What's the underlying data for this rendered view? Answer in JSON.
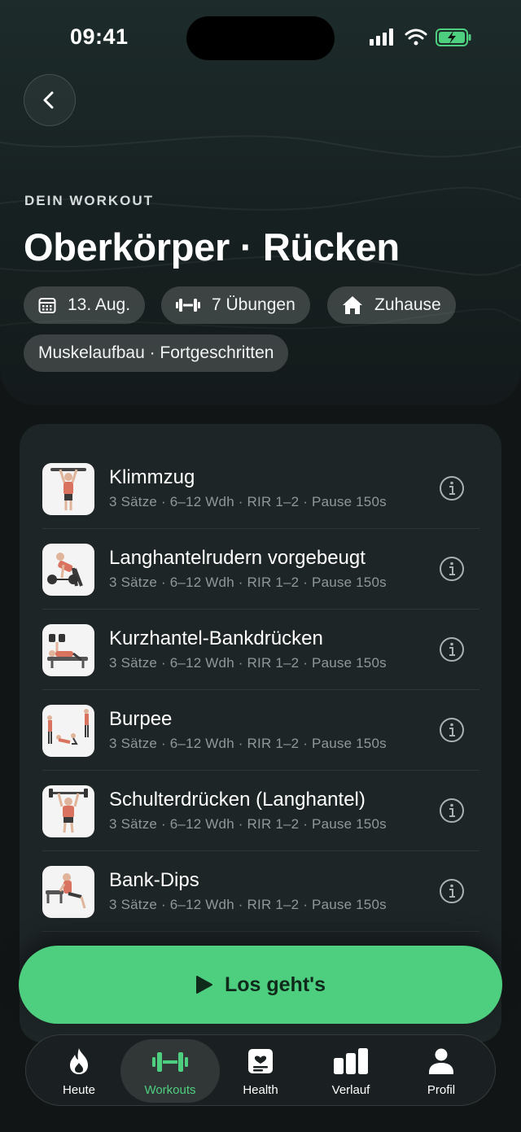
{
  "status": {
    "time": "09:41"
  },
  "header": {
    "eyebrow": "DEIN WORKOUT",
    "title": "Oberkörper · Rücken",
    "chips": [
      {
        "icon": "calendar-icon",
        "label": "13. Aug."
      },
      {
        "icon": "dumbbell-icon",
        "label": "7 Übungen"
      },
      {
        "icon": "home-icon",
        "label": "Zuhause"
      }
    ],
    "tag": "Muskelaufbau · Fortgeschritten"
  },
  "exercises": [
    {
      "name": "Klimmzug",
      "meta": "3 Sätze · 6–12 Wdh · RIR 1–2 · Pause 150s"
    },
    {
      "name": "Langhantelrudern vorgebeugt",
      "meta": "3 Sätze · 6–12 Wdh · RIR 1–2 · Pause 150s"
    },
    {
      "name": "Kurzhantel-Bankdrücken",
      "meta": "3 Sätze · 6–12 Wdh · RIR 1–2 · Pause 150s"
    },
    {
      "name": "Burpee",
      "meta": "3 Sätze · 6–12 Wdh · RIR 1–2 · Pause 150s"
    },
    {
      "name": "Schulterdrücken (Langhantel)",
      "meta": "3 Sätze · 6–12 Wdh · RIR 1–2 · Pause 150s"
    },
    {
      "name": "Bank-Dips",
      "meta": "3 Sätze · 6–12 Wdh · RIR 1–2 · Pause 150s"
    }
  ],
  "cta": {
    "label": "Los geht's"
  },
  "tabs": [
    {
      "label": "Heute",
      "icon": "flame-icon"
    },
    {
      "label": "Workouts",
      "icon": "dumbbell-icon",
      "active": true
    },
    {
      "label": "Health",
      "icon": "health-card-icon"
    },
    {
      "label": "Verlauf",
      "icon": "bar-chart-icon"
    },
    {
      "label": "Profil",
      "icon": "person-icon"
    }
  ],
  "colors": {
    "accent": "#4ecf80",
    "background": "#111516",
    "card": "#1e2526"
  }
}
